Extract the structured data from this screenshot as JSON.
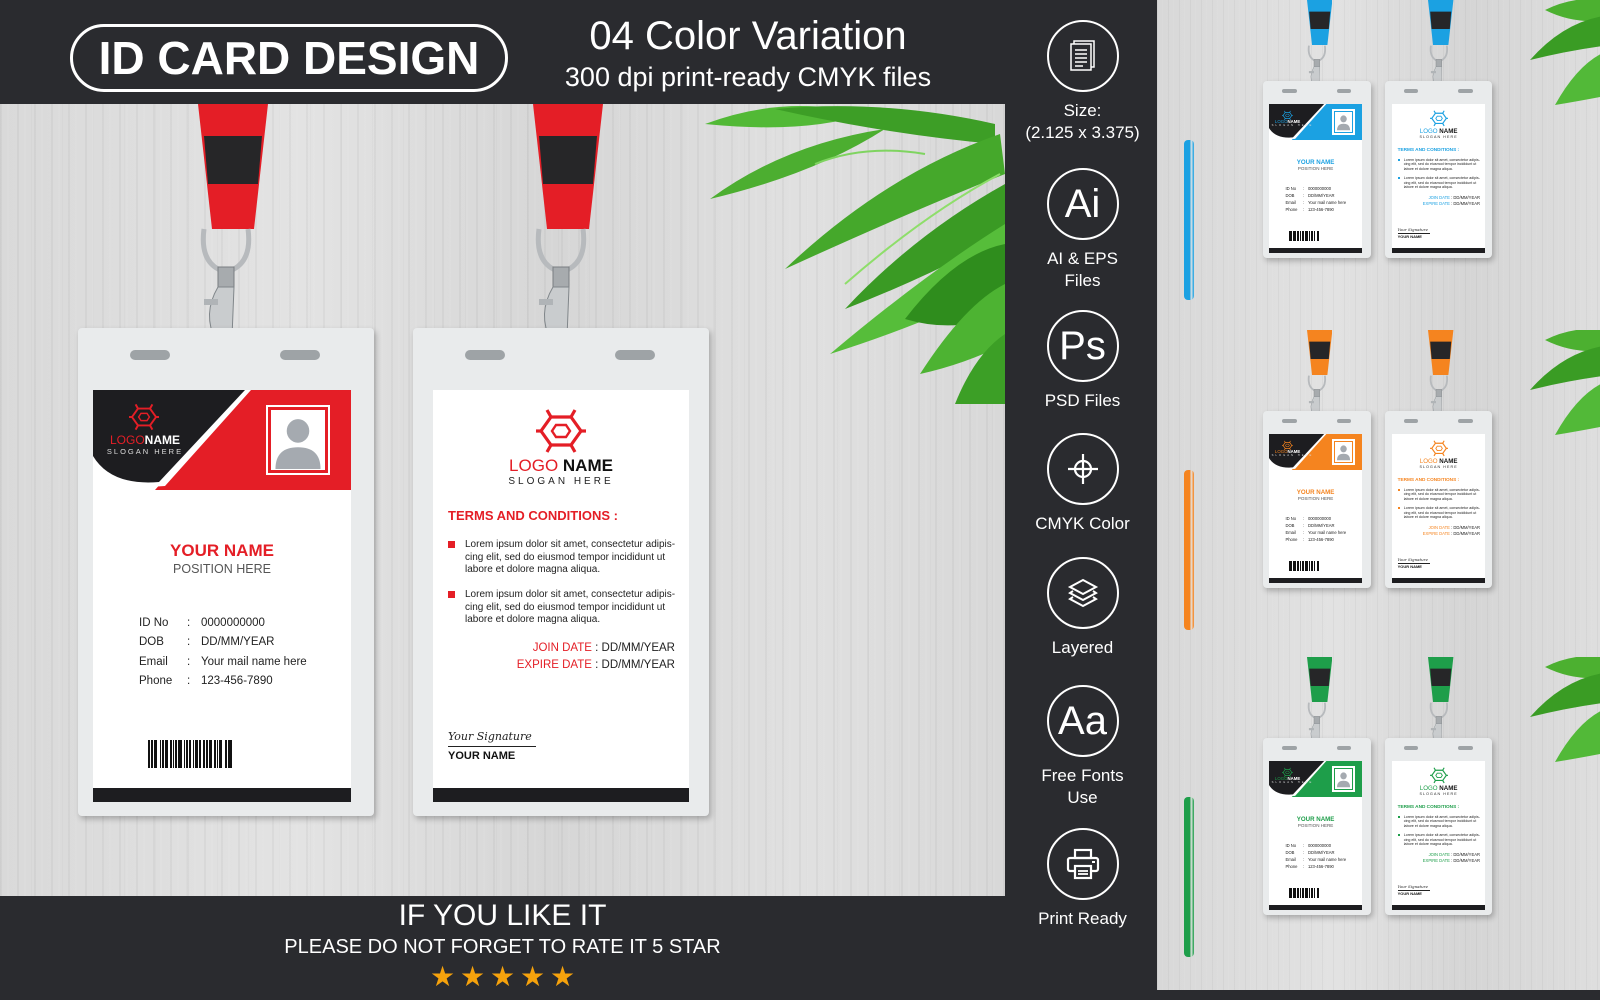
{
  "header": {
    "title": "ID CARD DESIGN",
    "subtitle_line1": "04 Color Variation",
    "subtitle_line2": "300 dpi print-ready CMYK files"
  },
  "footer": {
    "line1": "IF YOU LIKE IT",
    "line2": "PLEASE DO NOT FORGET TO RATE IT 5 STAR",
    "rating": 5,
    "rating_max": 5,
    "star_glyph": "★",
    "star_color": "#f5a20c"
  },
  "features": [
    {
      "icon": "document-icon",
      "glyph": "▤",
      "label_lines": [
        "Size:",
        "(2.125 x 3.375)"
      ]
    },
    {
      "icon": "illustrator-ai-icon",
      "glyph": "Ai",
      "label_lines": [
        "AI & EPS",
        "Files"
      ]
    },
    {
      "icon": "photoshop-ps-icon",
      "glyph": "Ps",
      "label_lines": [
        "PSD Files"
      ]
    },
    {
      "icon": "crosshair-registration-icon",
      "glyph": "⌖",
      "label_lines": [
        "CMYK Color"
      ]
    },
    {
      "icon": "layers-icon",
      "glyph": "≋",
      "label_lines": [
        "Layered"
      ]
    },
    {
      "icon": "font-aa-icon",
      "glyph": "Aa",
      "label_lines": [
        "Free Fonts",
        "Use"
      ]
    },
    {
      "icon": "printer-icon",
      "glyph": "⎙",
      "label_lines": [
        "Print Ready"
      ]
    }
  ],
  "card": {
    "logo_word1": "LOGO",
    "logo_word2": "NAME",
    "slogan": "SLOGAN HERE",
    "name": "YOUR NAME",
    "position": "POSITION HERE",
    "info": [
      {
        "label": "ID No",
        "sep": ":",
        "value": "0000000000"
      },
      {
        "label": "DOB",
        "sep": ":",
        "value": "DD/MM/YEAR"
      },
      {
        "label": "Email",
        "sep": ":",
        "value": "Your mail name here"
      },
      {
        "label": "Phone",
        "sep": ":",
        "value": "123-456-7890"
      }
    ],
    "terms_heading": "TERMS AND CONDITIONS :",
    "terms": [
      "Lorem ipsum dolor sit amet, consectetur adipis-cing elit, sed do eiusmod tempor incididunt ut labore et dolore magna aliqua.",
      "Lorem ipsum dolor sit amet, consectetur adipis-cing elit, sed do eiusmod tempor incididunt ut labore et dolore magna aliqua."
    ],
    "join_label": "JOIN DATE",
    "join_value": ": DD/MM/YEAR",
    "expire_label": "EXPIRE DATE",
    "expire_value": ": DD/MM/YEAR",
    "signature": "Your Signature",
    "signature_name": "YOUR NAME"
  },
  "main_variant": {
    "name": "red",
    "accent": "#e41e26"
  },
  "variants": [
    {
      "name": "blue",
      "accent": "#1ba1e2"
    },
    {
      "name": "orange",
      "accent": "#f5841f"
    },
    {
      "name": "green",
      "accent": "#1e9e4a"
    }
  ],
  "colors": {
    "background_dark": "#2a2b2f",
    "card_black": "#1d1d20"
  }
}
